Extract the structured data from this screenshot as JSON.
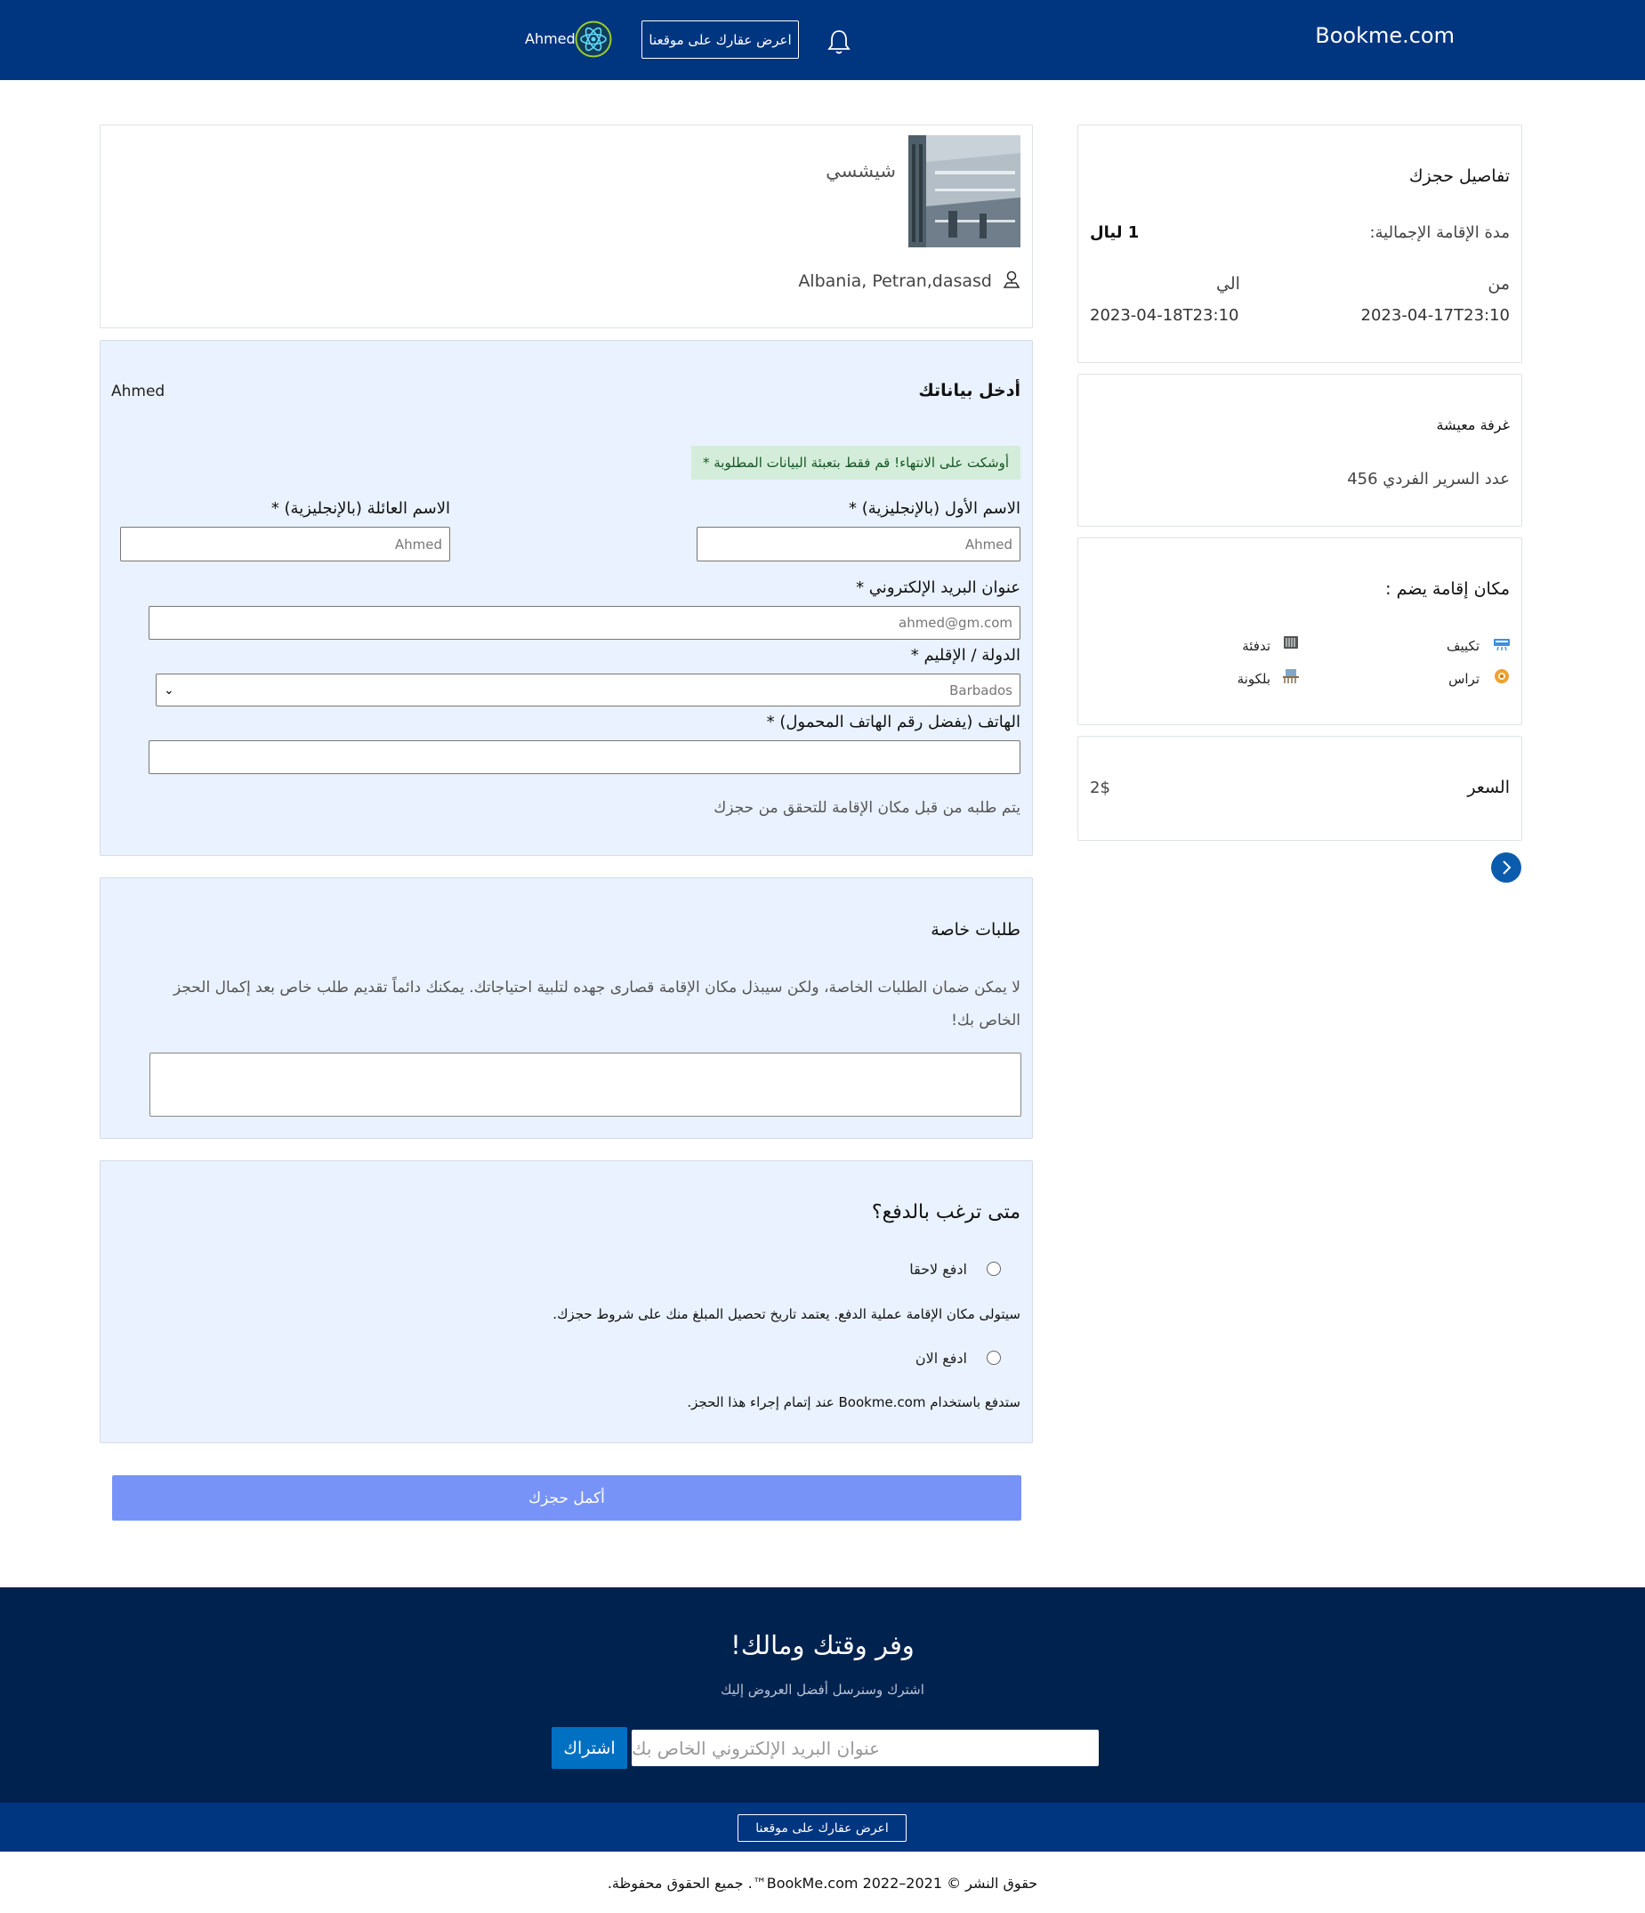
{
  "header": {
    "brand": "Bookme.com",
    "list_property": "اعرض عقارك على موقعنا",
    "user_name": "Ahmed"
  },
  "property": {
    "name": "شيشسي",
    "address": "Albania, Petran,dasasd"
  },
  "details_form": {
    "title": "أدخل بياناتك",
    "user_name": "Ahmed",
    "hint": "أوشكت على الانتهاء! قم فقط بتعبئة البيانات المطلوبة *",
    "first_name_label": "الاسم الأول (بالإنجليزية) *",
    "first_name_value": "Ahmed",
    "last_name_label": "الاسم العائلة (بالإنجليزية) *",
    "last_name_value": "Ahmed",
    "email_label": "عنوان البريد الإلكتروني *",
    "email_value": "ahmed@gm.com",
    "country_label": "الدولة / الإقليم *",
    "country_value": "Barbados",
    "phone_label": "الهاتف (يفضل رقم الهاتف المحمول) *",
    "phone_value": "",
    "phone_note": "يتم طلبه من قبل مكان الإقامة للتحقق من حجزك"
  },
  "special_requests": {
    "title": "طلبات خاصة",
    "text": "لا يمكن ضمان الطلبات الخاصة، ولكن سيبذل مكان الإقامة قصارى جهده لتلبية احتياجاتك. يمكنك دائماً تقديم طلب خاص بعد إكمال الحجز الخاص بك!"
  },
  "payment": {
    "title": "متى ترغب بالدفع؟",
    "later_label": "ادفع لاحقا",
    "later_note": "سيتولى مكان الإقامة عملية الدفع. يعتمد تاريخ تحصيل المبلغ منك على شروط حجزك.",
    "now_label": "ادفع الان",
    "now_note": "ستدفع باستخدام Bookme.com عند إتمام إجراء هذا الحجز."
  },
  "submit_label": "أكمل حجزك",
  "booking": {
    "title": "تفاصيل حجزك",
    "duration_label": "مدة الإقامة الإجمالية:",
    "duration_value": "1 ليال",
    "from_label": "من",
    "from_value": "2023-04-17T23:10",
    "to_label": "الي",
    "to_value": "2023-04-18T23:10"
  },
  "room": {
    "title": "غرفة معيشة",
    "bed_label": "عدد السرير الفردي 456"
  },
  "facilities": {
    "title": "مكان إقامة يضم :",
    "items": [
      {
        "label": "تكييف",
        "icon": "air-conditioner-icon"
      },
      {
        "label": "تدفئة",
        "icon": "heater-icon"
      },
      {
        "label": "تراس",
        "icon": "terrace-icon"
      },
      {
        "label": "بلكونة",
        "icon": "balcony-icon"
      }
    ]
  },
  "price": {
    "label": "السعر",
    "value": "2$"
  },
  "newsletter": {
    "title": "وفر وقتك ومالك!",
    "subtitle": "اشترك وسنرسل أفضل العروض إليك",
    "placeholder": "عنوان البريد الإلكتروني الخاص بك",
    "button": "اشتراك"
  },
  "footer": {
    "list_property": "اعرض عقارك على موقعنا",
    "copyright": "حقوق النشر © 2021–2022 BookMe.com™. جميع الحقوق محفوظة."
  },
  "colors": {
    "header": "#003580",
    "newsletter_bg": "#00224f",
    "form_bg": "#e9f2fe",
    "submit": "#7893f7",
    "accent": "#0071c2"
  }
}
